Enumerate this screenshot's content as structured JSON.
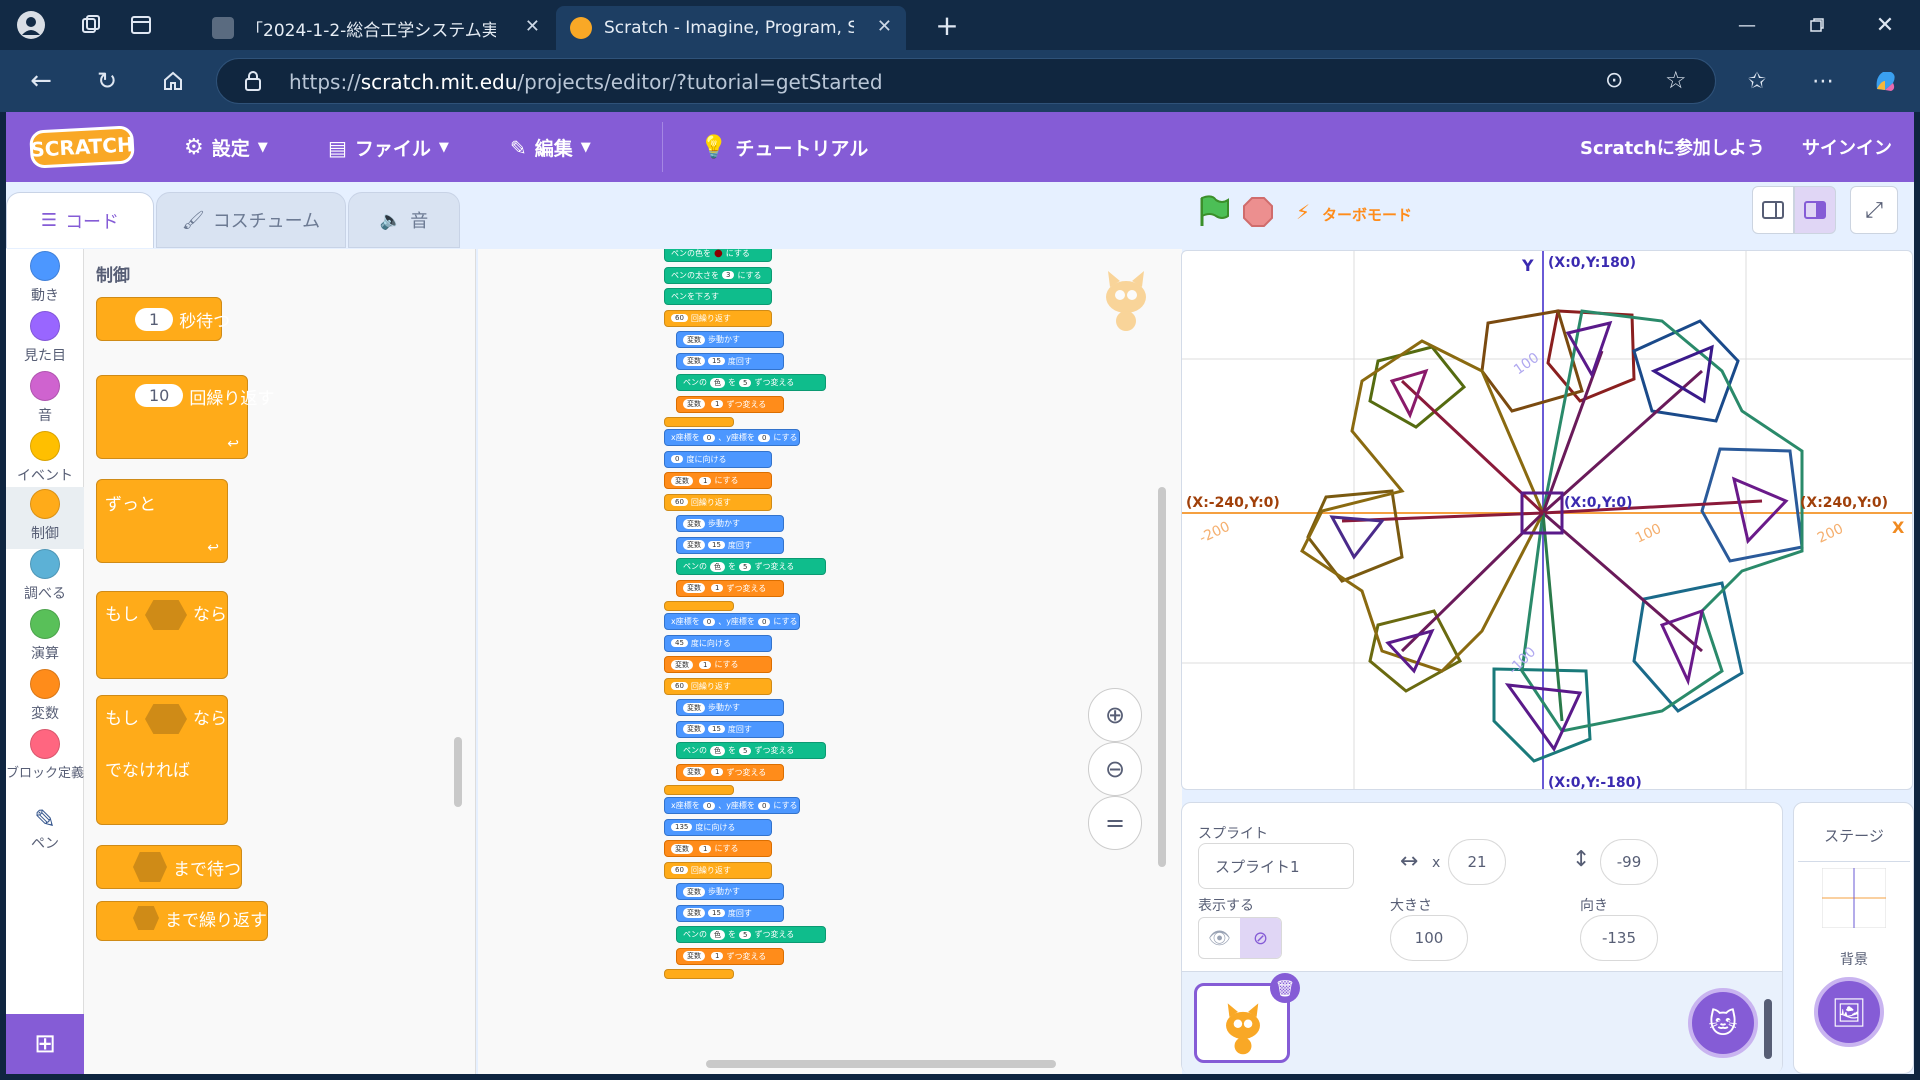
{
  "browser": {
    "tabs": [
      {
        "title": "「2024-1-2-総合工学システム実験実",
        "active": false
      },
      {
        "title": "Scratch - Imagine, Program, Share",
        "active": true
      }
    ],
    "url_prefix": "https://",
    "url_host": "scratch.mit.edu",
    "url_path": "/projects/editor/?tutorial=getStarted"
  },
  "menubar": {
    "logo": "SCRATCH",
    "settings": "設定",
    "file": "ファイル",
    "edit": "編集",
    "tutorial": "チュートリアル",
    "join": "Scratchに参加しよう",
    "signin": "サインイン"
  },
  "editor_tabs": {
    "code": "コード",
    "costumes": "コスチューム",
    "sounds": "音"
  },
  "categories": [
    {
      "label": "動き",
      "color": "#4c97ff"
    },
    {
      "label": "見た目",
      "color": "#9966ff"
    },
    {
      "label": "音",
      "color": "#cf63cf"
    },
    {
      "label": "イベント",
      "color": "#ffbf00"
    },
    {
      "label": "制御",
      "color": "#ffab19"
    },
    {
      "label": "調べる",
      "color": "#5cb1d6"
    },
    {
      "label": "演算",
      "color": "#59c059"
    },
    {
      "label": "変数",
      "color": "#ff8c1a"
    },
    {
      "label": "ブロック定義",
      "color": "#ff6680"
    },
    {
      "label": "ペン",
      "color": "#0fbd8c"
    }
  ],
  "palette": {
    "heading": "制御",
    "wait_value": "1",
    "wait_label": "秒待つ",
    "repeat_value": "10",
    "repeat_label": "回繰り返す",
    "forever_label": "ずっと",
    "if_label": "もし",
    "then_label": "なら",
    "if2_label": "もし",
    "then2_label": "なら",
    "else_label": "でなければ",
    "wait_until_label": "まで待つ",
    "repeat_until_label": "まで繰り返す"
  },
  "script": {
    "set_pen_color": "ペンの色を",
    "set_suffix": "にする",
    "set_pen_size": "ペンの太さを",
    "pen_size_value": "3",
    "pen_down": "ペンを下ろす",
    "repeat_n": "60",
    "repeat_label": "回繰り返す",
    "move": "変数",
    "move_suffix": "歩動かす",
    "turn_value": "15",
    "turn_suffix": "度回す",
    "var_name": "変数",
    "pen_change": "ペンの",
    "pen_change_prop": "色",
    "pen_change_by": "を",
    "pen_change_value": "5",
    "pen_change_suffix": "ずつ変える",
    "change_value": "1",
    "change_suffix": "ずつ変える",
    "goto_x": "x座標を",
    "goto_y": "、y座標を",
    "goto_zero": "0",
    "point_dir_1": "0",
    "point_dir_2": "45",
    "point_dir_3": "135",
    "point_suffix": "度に向ける",
    "set_var_value": "1"
  },
  "stage_header": {
    "turbo": "ターボモード"
  },
  "stage": {
    "y_axis_label": "Y",
    "x_axis_label": "X",
    "top_label": "(X:0,Y:180)",
    "bottom_label": "(X:0,Y:-180)",
    "left_label": "(X:-240,Y:0)",
    "right_label": "(X:240,Y:0)",
    "center_label": "(X:0,Y:0)",
    "tick_left": "-200",
    "tick_right": "200",
    "tick_100": "100",
    "tick_y100": "100",
    "tick_ym100": "-100",
    "colors": {
      "axis_x": "#f5a040",
      "axis_y": "#6a5ad6",
      "grid": "#dcdcdc"
    }
  },
  "sprite_panel": {
    "sprite_label": "スプライト",
    "sprite_name": "スプライト1",
    "x_label": "x",
    "x_value": "21",
    "y_label": "y",
    "y_value": "-99",
    "show_label": "表示する",
    "size_label": "大きさ",
    "size_value": "100",
    "direction_label": "向き",
    "direction_value": "-135"
  },
  "stage_panel": {
    "title": "ステージ",
    "backdrop_label": "背景"
  }
}
